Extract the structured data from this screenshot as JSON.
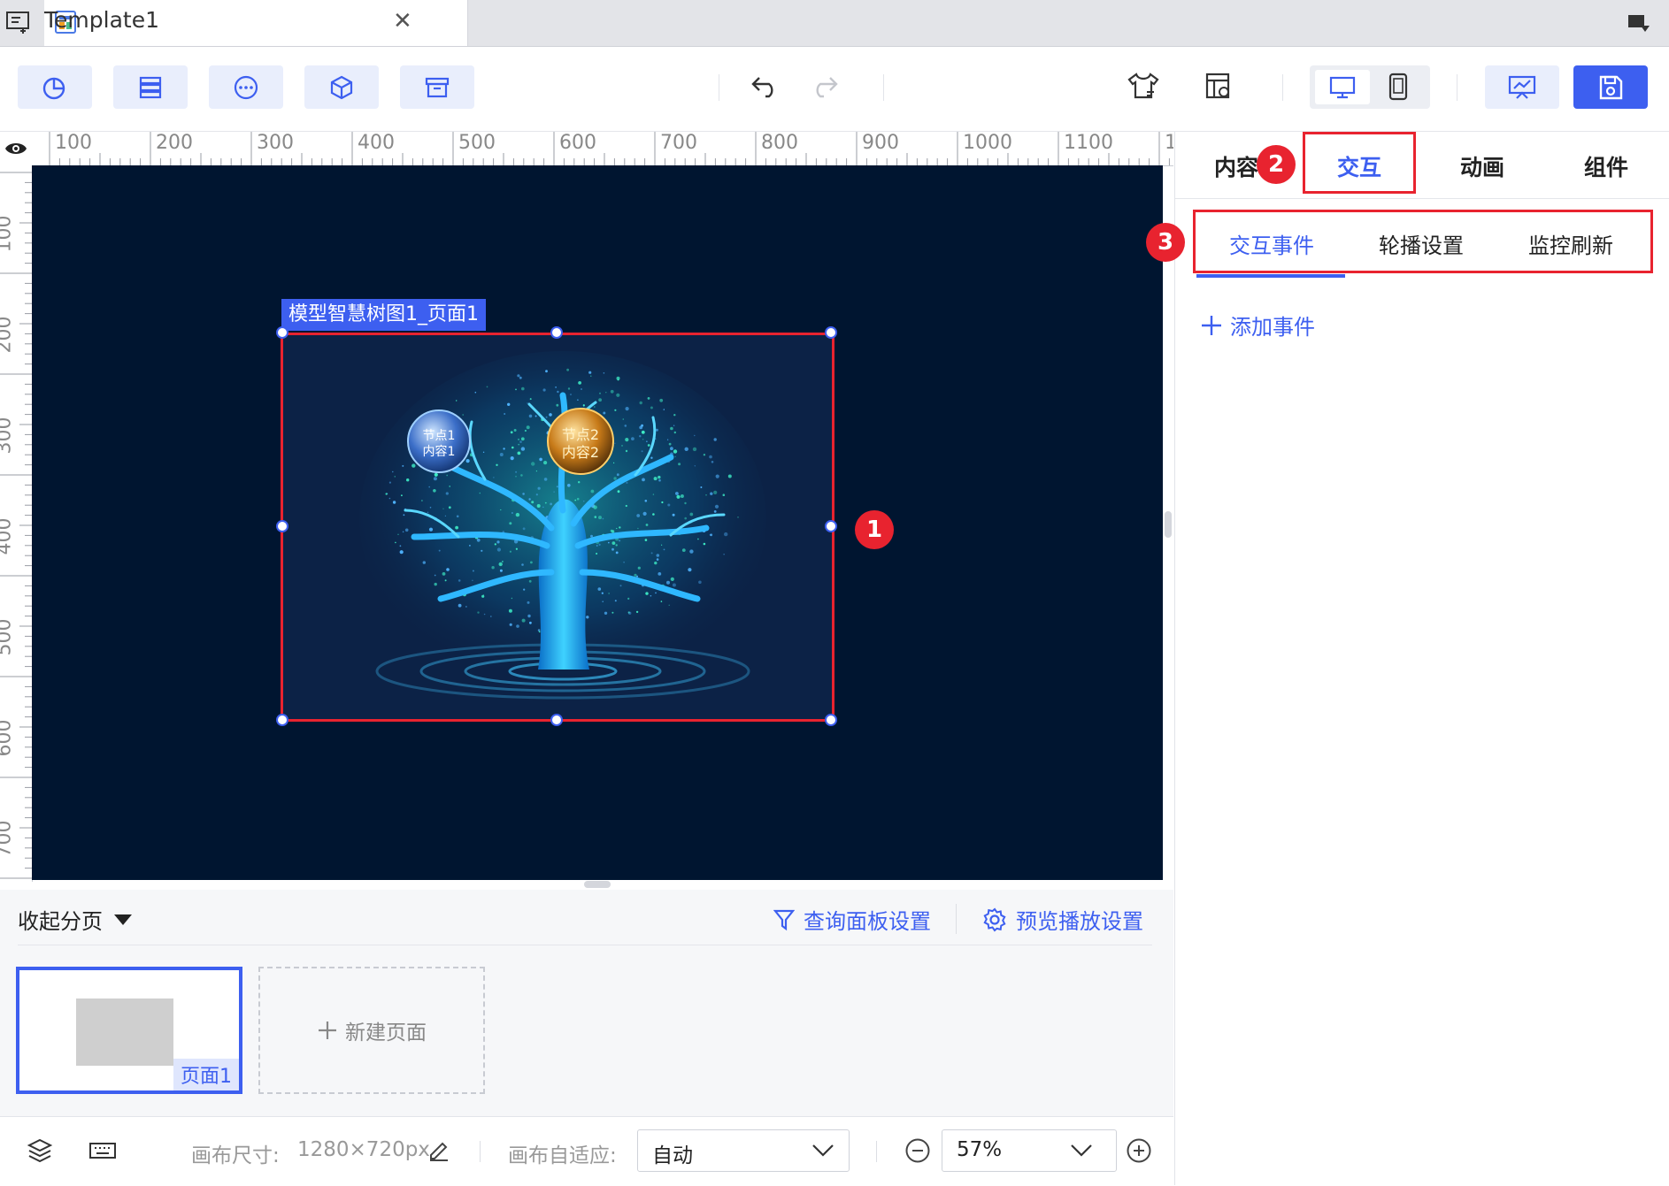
{
  "tab": {
    "title": "Template1",
    "close": "✕"
  },
  "ruler": {
    "h": [
      "100",
      "200",
      "300",
      "400",
      "500",
      "600",
      "700",
      "800",
      "900",
      "1000",
      "1100",
      "1"
    ],
    "v": [
      "100",
      "200",
      "300",
      "400",
      "500",
      "600",
      "700"
    ]
  },
  "component": {
    "label": "模型智慧树图1_页面1"
  },
  "tree": {
    "node1": {
      "line1": "节点1",
      "line2": "内容1"
    },
    "node2": {
      "line1": "节点2",
      "line2": "内容2"
    }
  },
  "markers": {
    "m1": "1",
    "m2": "2",
    "m3": "3"
  },
  "right_panel": {
    "tabs": [
      "内容",
      "交互",
      "动画",
      "组件"
    ],
    "subtabs": [
      "交互事件",
      "轮播设置",
      "监控刷新"
    ],
    "add_event": "添加事件"
  },
  "pages": {
    "collapse": "收起分页",
    "query_settings": "查询面板设置",
    "preview_settings": "预览播放设置",
    "page1": "页面1",
    "new_page": "新建页面"
  },
  "status": {
    "canvas_size_label": "画布尺寸:",
    "canvas_size_value": "1280×720px",
    "adapt_label": "画布自适应:",
    "adapt_value": "自动",
    "zoom": "57%"
  },
  "colors": {
    "accent": "#3d5ff0",
    "highlight": "#e8232f",
    "canvas_bg": "#001530"
  }
}
